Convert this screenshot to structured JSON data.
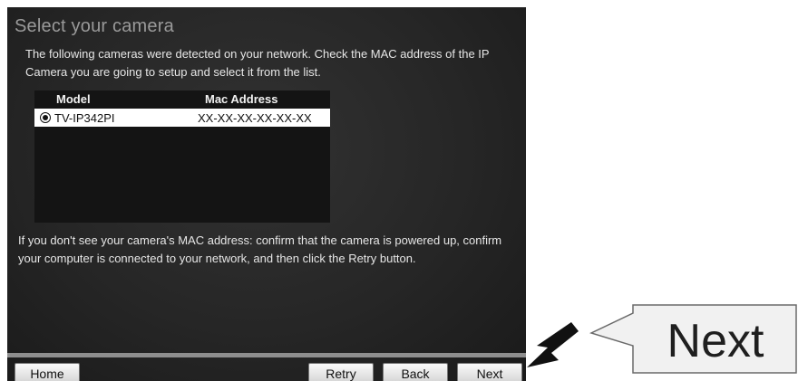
{
  "wizard": {
    "title": "Select your camera",
    "intro": "The following cameras were detected on your network. Check the MAC address of the IP Camera you are going to setup and select it from the list.",
    "list": {
      "columns": [
        "Model",
        "Mac Address"
      ],
      "rows": [
        {
          "model": "TV-IP342PI",
          "mac": "XX-XX-XX-XX-XX-XX",
          "selected": true
        }
      ]
    },
    "help": "If you don't see your camera's MAC address: confirm that the camera is powered up, confirm your computer is connected to your network, and then click the Retry button.",
    "buttons": {
      "home": "Home",
      "retry": "Retry",
      "back": "Back",
      "next": "Next"
    }
  },
  "annotation": {
    "callout_label": "Next",
    "arrow_icon": "pointer-arrow-icon"
  },
  "colors": {
    "panel_background": "#262626",
    "footer_line": "#8e8e8e",
    "title_text": "#9a9a9a"
  }
}
